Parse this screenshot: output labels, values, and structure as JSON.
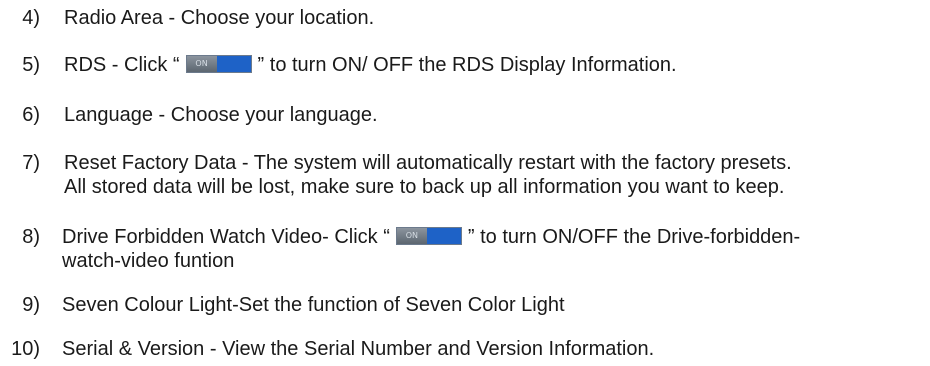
{
  "items": [
    {
      "number": "4)",
      "text": "Radio Area - Choose your location."
    },
    {
      "number": "5)",
      "before": "RDS - Click “",
      "toggle_label": "ON",
      "after": "” to turn ON/ OFF the RDS Display Information."
    },
    {
      "number": "6)",
      "text": "Language - Choose your language."
    },
    {
      "number": "7)",
      "line1": "Reset Factory Data - The system will automatically restart with the factory presets.",
      "line2": "All stored data will be lost, make sure to back up all information you want to keep."
    },
    {
      "number": "8)",
      "before": "Drive Forbidden Watch Video-  Click “",
      "toggle_label": "ON",
      "after": "” to turn ON/OFF the Drive-forbidden-",
      "line2": "watch-video funtion"
    },
    {
      "number": "9)",
      "text": "Seven Colour Light-Set the function of Seven Color Light"
    },
    {
      "number": "10)",
      "text": "Serial & Version - View the Serial Number and Version Information."
    }
  ],
  "colors": {
    "toggle_blue": "#1e62c7",
    "toggle_knob": "#6f7882",
    "text": "#1a1a1a"
  }
}
